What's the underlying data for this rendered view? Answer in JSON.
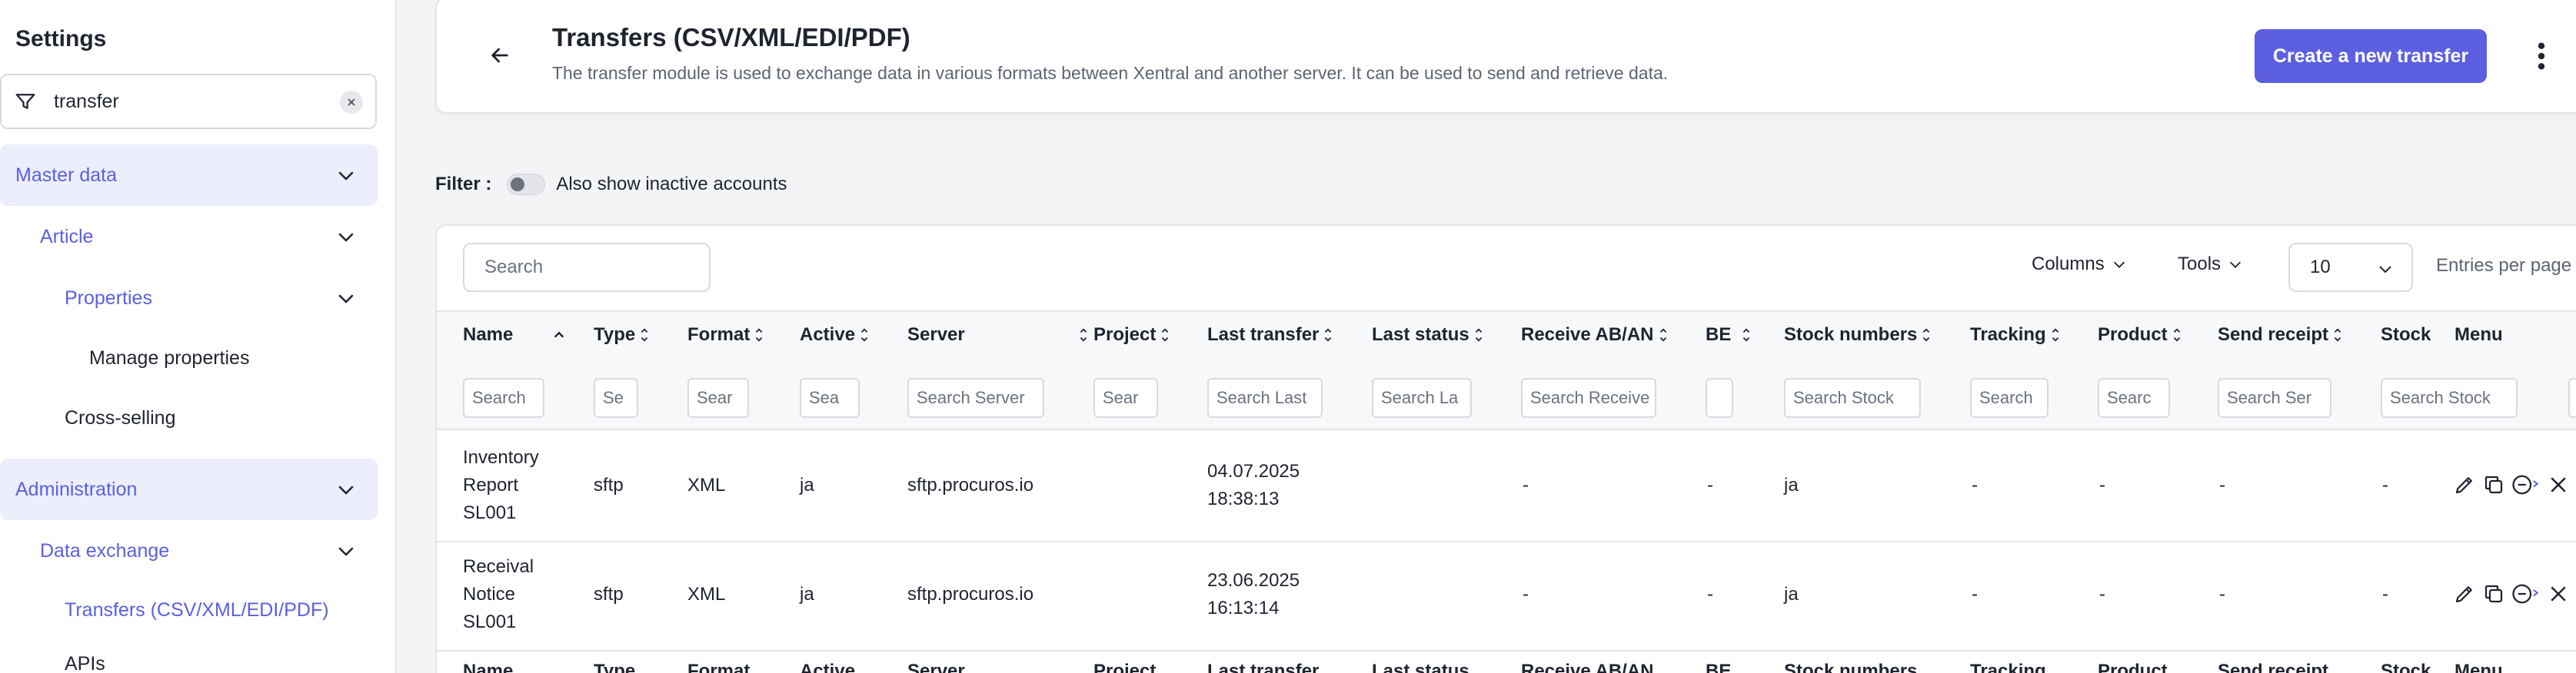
{
  "sidebar": {
    "title": "Settings",
    "search": {
      "value": "transfer",
      "placeholder": "Search"
    },
    "items": [
      {
        "label": "Master data",
        "type": "section"
      },
      {
        "label": "Article",
        "type": "group"
      },
      {
        "label": "Properties",
        "type": "group"
      },
      {
        "label": "Manage properties",
        "type": "leaf"
      },
      {
        "label": "Cross-selling",
        "type": "leaf"
      },
      {
        "label": "Administration",
        "type": "section"
      },
      {
        "label": "Data exchange",
        "type": "group"
      },
      {
        "label": "Transfers (CSV/XML/EDI/PDF)",
        "type": "active"
      },
      {
        "label": "APIs",
        "type": "leaf"
      }
    ]
  },
  "header": {
    "title": "Transfers (CSV/XML/EDI/PDF)",
    "subtitle": "The transfer module is used to exchange data in various formats between Xentral and another server. It can be used to send and retrieve data.",
    "create_label": "Create a new transfer"
  },
  "filter": {
    "label": "Filter :",
    "toggle_label": "Also show inactive accounts",
    "toggle_on": false
  },
  "toolbar": {
    "search_placeholder": "Search",
    "columns_label": "Columns",
    "tools_label": "Tools",
    "per_page_value": "10",
    "per_page_label": "Entries per page"
  },
  "table": {
    "columns": [
      {
        "label": "Name",
        "filter": "Search"
      },
      {
        "label": "Type",
        "filter": "Se"
      },
      {
        "label": "Format",
        "filter": "Sear"
      },
      {
        "label": "Active",
        "filter": "Sea"
      },
      {
        "label": "Server",
        "filter": "Search Server"
      },
      {
        "label": "Project",
        "filter": "Sear"
      },
      {
        "label": "Last transfer",
        "filter": "Search Last"
      },
      {
        "label": "Last status",
        "filter": "Search La"
      },
      {
        "label": "Receive AB/AN",
        "filter": "Search Receive"
      },
      {
        "label": "BE",
        "filter": ""
      },
      {
        "label": "Stock numbers",
        "filter": "Search Stock"
      },
      {
        "label": "Tracking",
        "filter": "Search"
      },
      {
        "label": "Product",
        "filter": "Searc"
      },
      {
        "label": "Send receipt",
        "filter": "Search Ser"
      },
      {
        "label": "Stock",
        "filter": "Search Stock"
      },
      {
        "label": "Menu",
        "filter": ""
      }
    ],
    "rows": [
      {
        "name": [
          "Inventory",
          "Report",
          "SL001"
        ],
        "type": "sftp",
        "format": "XML",
        "active": "ja",
        "server": "sftp.procuros.io",
        "project": "",
        "last_transfer": [
          "04.07.2025",
          "18:38:13"
        ],
        "last_status": "",
        "receive": "-",
        "be": "-",
        "stock_numbers": "ja",
        "tracking": "-",
        "product": "-",
        "send_receipt": "-",
        "stock": "-"
      },
      {
        "name": [
          "Receival",
          "Notice",
          "SL001"
        ],
        "type": "sftp",
        "format": "XML",
        "active": "ja",
        "server": "sftp.procuros.io",
        "project": "",
        "last_transfer": [
          "23.06.2025",
          "16:13:14"
        ],
        "last_status": "",
        "receive": "-",
        "be": "-",
        "stock_numbers": "ja",
        "tracking": "-",
        "product": "-",
        "send_receipt": "-",
        "stock": "-"
      }
    ]
  },
  "icons": {
    "filter": "filter-icon",
    "clear": "close-icon",
    "chevron": "chevron-down-icon",
    "back": "arrow-left-icon",
    "kebab": "more-vertical-icon",
    "edit": "pencil-icon",
    "copy": "copy-icon",
    "disable": "minus-circle-icon",
    "delete": "x-icon"
  },
  "colors": {
    "accent": "#5b5fe0",
    "section_bg": "#eceefb"
  }
}
